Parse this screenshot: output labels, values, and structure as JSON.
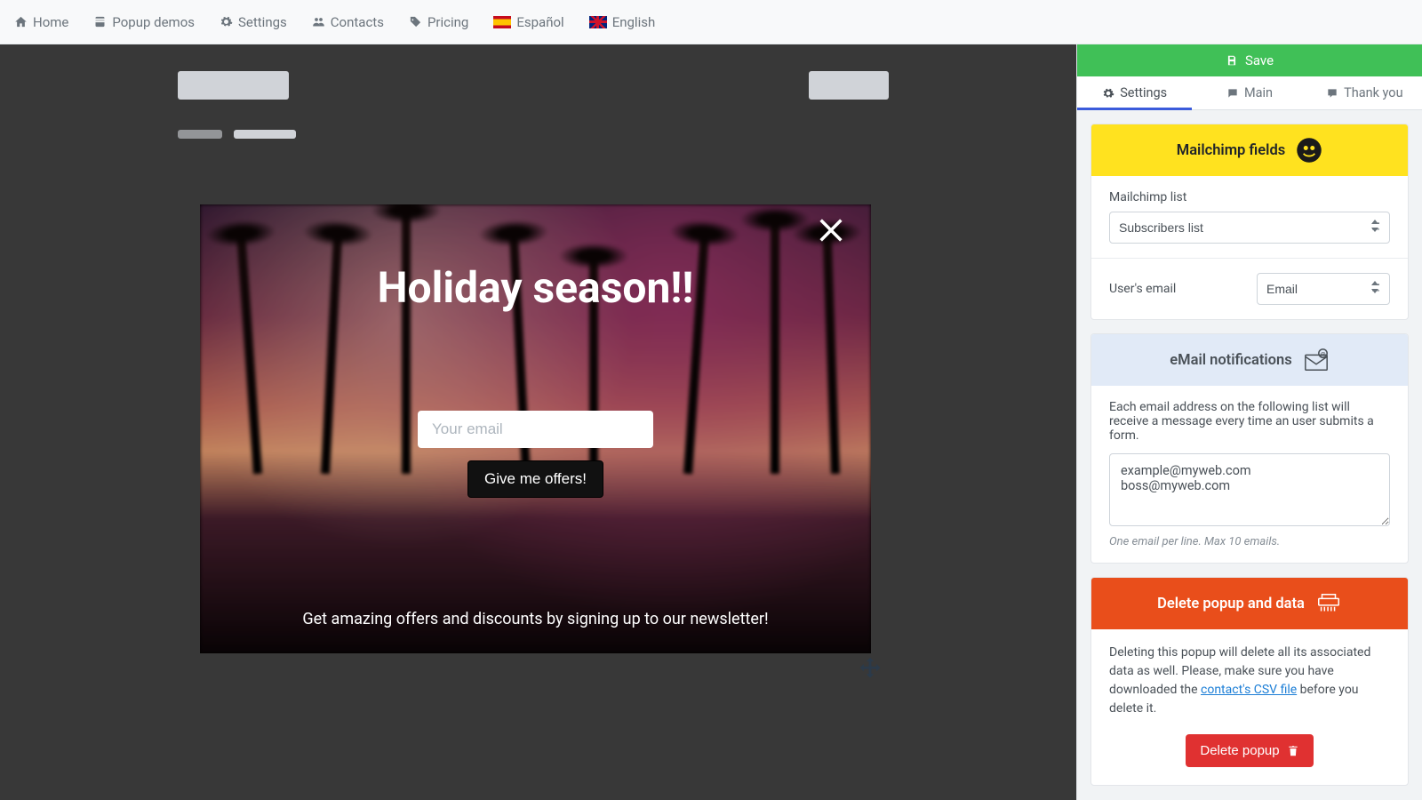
{
  "nav": {
    "home": "Home",
    "popup_demos": "Popup demos",
    "settings": "Settings",
    "contacts": "Contacts",
    "pricing": "Pricing",
    "spanish": "Español",
    "english": "English"
  },
  "save_label": "Save",
  "tabs": {
    "settings": "Settings",
    "main": "Main",
    "thankyou": "Thank you"
  },
  "popup": {
    "title": "Holiday season!!",
    "email_placeholder": "Your email",
    "button": "Give me offers!",
    "subtitle": "Get amazing offers and discounts by signing up to our newsletter!"
  },
  "mailchimp": {
    "header": "Mailchimp fields",
    "list_label": "Mailchimp list",
    "list_value": "Subscribers list",
    "user_email_label": "User's email",
    "user_email_value": "Email"
  },
  "notif": {
    "header": "eMail notifications",
    "desc": "Each email address on the following list will receive a message every time an user submits a form.",
    "value": "example@myweb.com\nboss@myweb.com",
    "hint": "One email per line. Max 10 emails."
  },
  "delete": {
    "header": "Delete popup and data",
    "desc_1": "Deleting this popup will delete all its associated data as well. Please, make sure you have downloaded the ",
    "link": "contact's CSV file",
    "desc_2": " before you delete it.",
    "button": "Delete popup"
  }
}
